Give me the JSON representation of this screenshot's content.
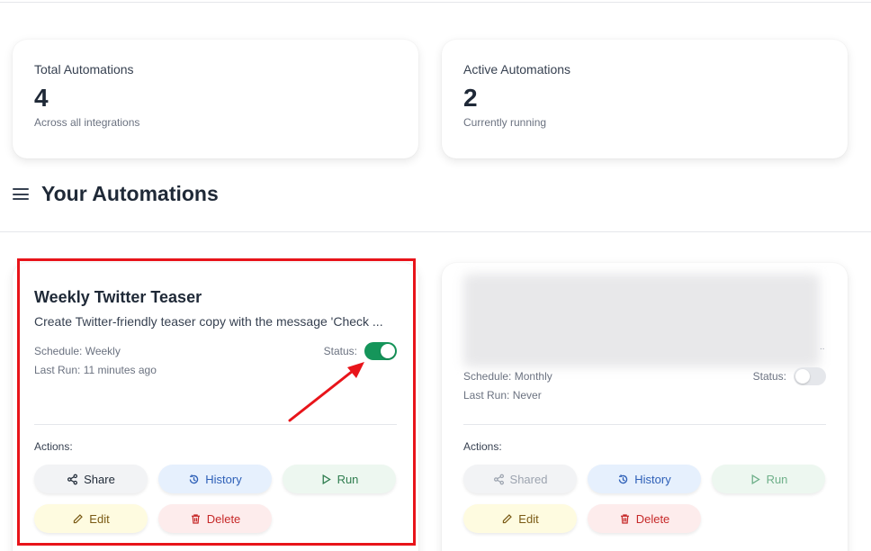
{
  "stats": [
    {
      "title": "Total Automations",
      "value": "4",
      "sub": "Across all integrations"
    },
    {
      "title": "Active Automations",
      "value": "2",
      "sub": "Currently running"
    }
  ],
  "section": {
    "title": "Your Automations",
    "icon": "menu-icon"
  },
  "automations": [
    {
      "title": "Weekly Twitter Teaser",
      "description": "Create Twitter-friendly teaser copy with the message 'Check ...",
      "schedule_label": "Schedule:",
      "schedule_value": "Weekly",
      "status_label": "Status:",
      "status_on": true,
      "lastrun_label": "Last Run:",
      "lastrun_value": "11 minutes ago",
      "actions_label": "Actions:",
      "buttons": {
        "share": "Share",
        "history": "History",
        "run": "Run",
        "edit": "Edit",
        "delete": "Delete"
      }
    },
    {
      "title": "",
      "description": "",
      "ellipsis": "..",
      "schedule_label": "Schedule:",
      "schedule_value": "Monthly",
      "status_label": "Status:",
      "status_on": false,
      "lastrun_label": "Last Run:",
      "lastrun_value": "Never",
      "actions_label": "Actions:",
      "buttons": {
        "share": "Shared",
        "history": "History",
        "run": "Run",
        "edit": "Edit",
        "delete": "Delete"
      }
    }
  ],
  "colors": {
    "toggle_on": "#15955a",
    "highlight": "#e8141a",
    "arrow": "#e8141a"
  }
}
